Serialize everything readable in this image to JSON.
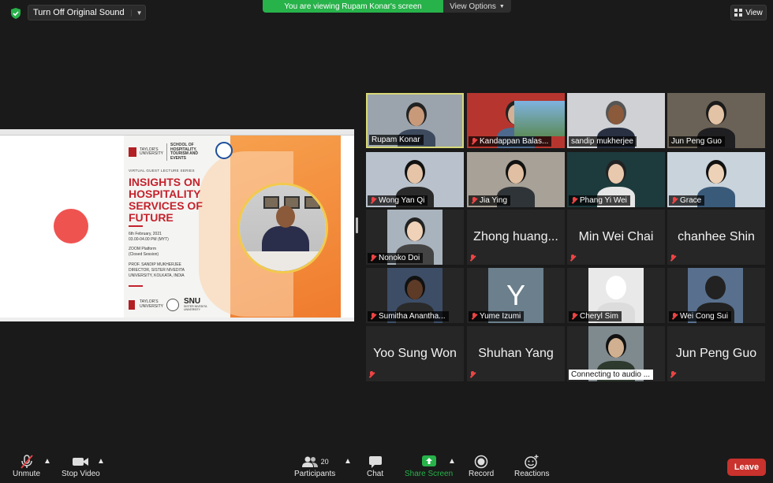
{
  "top": {
    "sound_button": "Turn Off Original Sound",
    "banner_text": "You are viewing Rupam Konar's screen",
    "view_options": "View Options",
    "view_button": "View"
  },
  "shared_slide": {
    "logo_top_left": "TAYLOR'S UNIVERSITY",
    "school": "SCHOOL OF HOSPITALITY, TOURISM AND EVENTS",
    "series": "VIRTUAL GUEST LECTURE SERIES",
    "title": "INSIGHTS ON HOSPITALITY SERVICES OF FUTURE",
    "date": "6th February, 2021",
    "time": "03.00-04.00 PM (MYT)",
    "platform": "ZOOM Platform",
    "session": "(Closed Session)",
    "speaker": "PROF. SANDIP MUKHERJEE",
    "speaker_role": "DIRECTOR, SISTER NIVEDITA UNIVERSITY, KOLKATA, INDIA",
    "logo_bottom": "TAYLOR'S UNIVERSITY",
    "snu": "SNU",
    "snu_sub": "SISTER NIVEDITA UNIVERSITY"
  },
  "participants": [
    {
      "name": "Rupam Konar",
      "type": "video"
    },
    {
      "name": "Kandappan Balas...",
      "type": "video"
    },
    {
      "name": "sandip mukherjee",
      "type": "video"
    },
    {
      "name": "Jun Peng Guo",
      "type": "video"
    },
    {
      "name": "Wong Yan Qi",
      "type": "video"
    },
    {
      "name": "Jia Ying",
      "type": "video"
    },
    {
      "name": "Phang Yi Wei",
      "type": "video"
    },
    {
      "name": "Grace",
      "type": "video"
    },
    {
      "name": "Nonoko Doi",
      "type": "video"
    },
    {
      "name": "Zhong huang...",
      "type": "name"
    },
    {
      "name": "Min Wei Chai",
      "type": "name"
    },
    {
      "name": "chanhee Shin",
      "type": "name"
    },
    {
      "name": "Sumitha Anantha...",
      "type": "video"
    },
    {
      "name": "Yume Izumi",
      "type": "avatar",
      "initial": "Y"
    },
    {
      "name": "Cheryl Sim",
      "type": "video"
    },
    {
      "name": "Wei Cong Sui",
      "type": "video"
    },
    {
      "name": "Yoo Sung Won",
      "type": "name"
    },
    {
      "name": "Shuhan Yang",
      "type": "name"
    },
    {
      "name": "Connecting to audio ...",
      "type": "video"
    },
    {
      "name": "Jun Peng Guo",
      "type": "name"
    }
  ],
  "toolbar": {
    "unmute": "Unmute",
    "stop_video": "Stop Video",
    "participants": "Participants",
    "participants_count": "20",
    "chat": "Chat",
    "share_screen": "Share Screen",
    "record": "Record",
    "reactions": "Reactions",
    "leave": "Leave"
  },
  "colors": {
    "share_green": "#27b24a",
    "leave_red": "#c9322d",
    "active_border": "#d8d878",
    "muted_red": "#ee4444"
  }
}
